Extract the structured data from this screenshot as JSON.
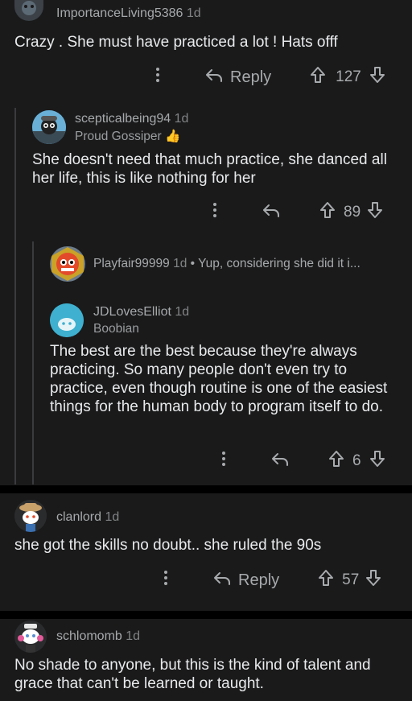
{
  "comments": [
    {
      "username": "ImportanceLiving5386",
      "time": "1d",
      "body": "Crazy . She must have practiced a lot ! Hats offf",
      "reply_label": "Reply",
      "score": "127"
    },
    {
      "username": "scepticalbeing94",
      "time": "1d",
      "flair": "Proud Gossiper",
      "flair_emoji": "👍",
      "body": "She doesn't need that much practice, she danced all her life, this is like nothing for her",
      "score": "89"
    },
    {
      "username": "Playfair99999",
      "time": "1d",
      "preview": "• Yup, considering she did it i..."
    },
    {
      "username": "JDLovesElliot",
      "time": "1d",
      "flair": "Boobian",
      "body": "The best are the best because they're always practicing. So many people don't even try to practice, even though routine is one of the easiest things for the human body to program itself to do.",
      "score": "6"
    },
    {
      "username": "clanlord",
      "time": "1d",
      "body": "she got the skills no doubt.. she ruled the 90s",
      "reply_label": "Reply",
      "score": "57"
    },
    {
      "username": "schlomomb",
      "time": "1d",
      "body": "No shade to anyone, but this is the kind of talent and grace that can't be learned or taught."
    }
  ],
  "icons": {
    "more": "more-vertical-icon",
    "reply": "reply-arrow-icon",
    "upvote": "upvote-arrow-icon",
    "downvote": "downvote-arrow-icon"
  },
  "colors": {
    "background": "#1a1a1b",
    "separator": "#000000",
    "text": "#e8eaec",
    "meta": "#a6a9ab",
    "flair_emoji": "#f5a623"
  }
}
